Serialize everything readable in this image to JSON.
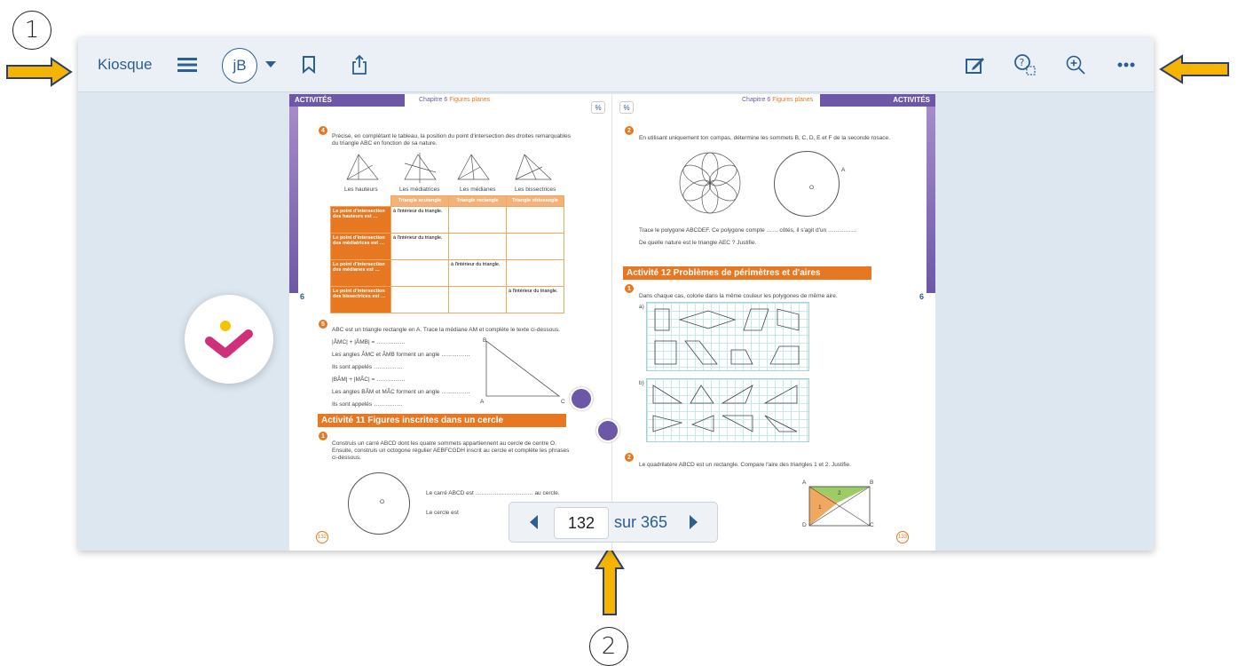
{
  "annotations": {
    "callout_1": "1",
    "callout_2": "2"
  },
  "toolbar": {
    "kiosque_label": "Kiosque",
    "avatar_initials": "jB"
  },
  "book": {
    "left": {
      "header": "ACTIVITÉS",
      "chapter": "Chapitre 6",
      "chapter_topic": "Figures planes",
      "side_number": "6",
      "q4_badge": "4",
      "q4_text": "Précise, en complétant le tableau, la position du point d'intersection des droites remarquables du triangle ABC en fonction de sa nature.",
      "fig_labels": [
        "Les hauteurs",
        "Les médiatrices",
        "Les médianes",
        "Les bissectrices"
      ],
      "table_headers": [
        "Triangle acutangle",
        "Triangle rectangle",
        "Triangle obtusangle"
      ],
      "table_rows": [
        {
          "label": "Le point d'intersection des hauteurs est …",
          "cells": [
            "à l'intérieur du triangle.",
            "",
            ""
          ]
        },
        {
          "label": "Le point d'intersection des médiatrices est …",
          "cells": [
            "à l'intérieur du triangle.",
            "",
            ""
          ]
        },
        {
          "label": "Le point d'intersection des médianes est …",
          "cells": [
            "",
            "à l'intérieur du triangle.",
            ""
          ]
        },
        {
          "label": "Le point d'intersection des bissectrices est …",
          "cells": [
            "",
            "",
            "à l'intérieur du triangle."
          ]
        }
      ],
      "q5_badge": "5",
      "q5_lines": [
        "ABC est un triangle rectangle en A. Trace la médiane AM et complète le texte ci-dessous.",
        "|ÂMC| + |ÂMB| = ……………",
        "Les angles ÂMC et ÂMB forment un angle ……………",
        "Ils sont appelés ……………",
        "|BÂM| + |MÂC| = ……………",
        "Les angles BÂM et MÂC forment un angle ……………",
        "Ils sont appelés ……………"
      ],
      "tri_labels": [
        "B",
        "A",
        "C"
      ],
      "activity_title": "Activité 11 Figures inscrites dans un cercle",
      "a11_badge": "1",
      "a11_text": "Construis un carré ABCD dont les quatre sommets appartiennent au cercle de centre O. Ensuite, construis un octogone régulier AEBFCGDH inscrit au cercle et complète les phrases ci-dessous.",
      "circle_center": "O",
      "sentence_1": "Le carré ABCD est ………………………… au cercle.",
      "sentence_2": "Le cercle est",
      "page_number": "132"
    },
    "right": {
      "header": "ACTIVITÉS",
      "chapter": "Chapitre 6",
      "chapter_topic": "Figures planes",
      "side_number": "6",
      "q2_badge": "2",
      "q2_text": "En utilisant uniquement ton compas, détermine les sommets B, C, D, E et F de la seconde rosace.",
      "circle_labels": [
        "A",
        "O"
      ],
      "q2_line_1": "Trace le polygone ABCDEF. Ce polygone compte …… côtés, il s'agit d'un ……………",
      "q2_line_2": "De quelle nature est le triangle AEC ? Justifie.",
      "activity_title": "Activité 12 Problèmes de périmètres et d'aires",
      "a12_badge": "1",
      "a12_text": "Dans chaque cas, colorie dans la même couleur les polygones de même aire.",
      "part_a": "a)",
      "part_b": "b)",
      "q2b_badge": "2",
      "q2b_text": "Le quadrilatère ABCD est un rectangle. Compare l'aire des triangles 1 et 2. Justifie.",
      "rect_labels": [
        "A",
        "B",
        "D",
        "C",
        "1",
        "2"
      ],
      "page_number": "133"
    }
  },
  "pager": {
    "current_page": "132",
    "total_label": "sur 365"
  },
  "colors": {
    "toolbar_bg": "#eaf0f6",
    "brand_blue": "#2a5f93",
    "arrow_fill": "#f5b400",
    "activity_orange": "#e87722",
    "purple": "#6d58a8",
    "logo_pink": "#d0307a"
  },
  "icons": [
    "menu-icon",
    "chevron-down-icon",
    "bookmark-icon",
    "share-icon",
    "edit-icon",
    "help-icon",
    "zoom-in-icon",
    "more-icon"
  ]
}
